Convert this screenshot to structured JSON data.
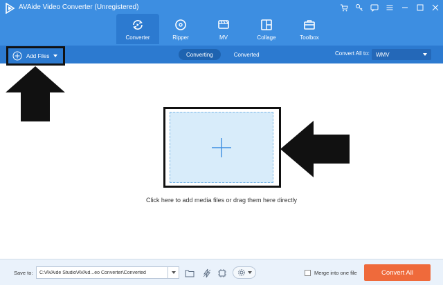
{
  "app": {
    "title": "AVAide Video Converter (Unregistered)",
    "accent": "#3d8ee1",
    "toolbar_color": "#2c7ad0",
    "convert_color": "#ef6a3b"
  },
  "window_controls": {
    "icons": [
      "cart-icon",
      "key-icon",
      "chat-icon",
      "menu-icon",
      "minimize-icon",
      "maximize-icon",
      "close-icon"
    ]
  },
  "nav": {
    "items": [
      {
        "label": "Converter",
        "icon": "converter-icon",
        "active": true
      },
      {
        "label": "Ripper",
        "icon": "ripper-icon",
        "active": false
      },
      {
        "label": "MV",
        "icon": "mv-icon",
        "active": false
      },
      {
        "label": "Collage",
        "icon": "collage-icon",
        "active": false
      },
      {
        "label": "Toolbox",
        "icon": "toolbox-icon",
        "active": false
      }
    ]
  },
  "toolbar": {
    "add_files_label": "Add Files",
    "tabs": [
      {
        "label": "Converting",
        "active": true
      },
      {
        "label": "Converted",
        "active": false
      }
    ],
    "convert_all_label": "Convert All to:",
    "format_value": "WMV"
  },
  "main": {
    "drop_hint": "Click here to add media files or drag them here directly"
  },
  "bottom": {
    "save_to_label": "Save to:",
    "save_path": "C:\\AVAide Studio\\AVAid...eo Converter\\Converted",
    "merge_label": "Merge into one file",
    "merge_checked": false,
    "convert_all_button": "Convert All"
  }
}
